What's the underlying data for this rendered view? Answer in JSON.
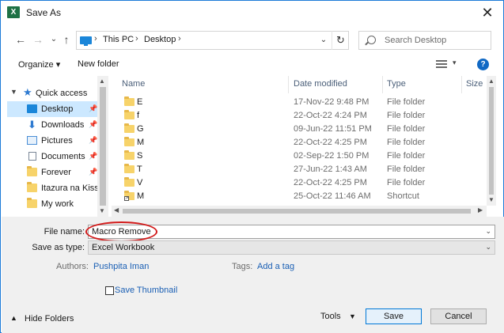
{
  "window": {
    "title": "Save As",
    "app_icon_letter": "X",
    "close_glyph": "✕"
  },
  "address": {
    "crumbs": [
      "This PC",
      "Desktop"
    ],
    "separator": "›",
    "dropdown_glyph": "⌄",
    "refresh_glyph": "↻",
    "back_glyph": "←",
    "forward_glyph": "→",
    "recent_glyph": "⌄",
    "up_glyph": "↑"
  },
  "search": {
    "placeholder": "Search Desktop"
  },
  "toolbar": {
    "organize_label": "Organize ▾",
    "new_folder_label": "New folder",
    "view_drop_glyph": "▾",
    "help_glyph": "?"
  },
  "nav": {
    "quick_access": "Quick access",
    "items": [
      {
        "label": "Desktop",
        "icon": "desktop-icon",
        "pinned": true,
        "selected": true
      },
      {
        "label": "Downloads",
        "icon": "download-icon",
        "pinned": true
      },
      {
        "label": "Pictures",
        "icon": "pictures-icon",
        "pinned": true
      },
      {
        "label": "Documents",
        "icon": "documents-icon",
        "pinned": true
      },
      {
        "label": "Forever",
        "icon": "folder-icon",
        "pinned": true
      },
      {
        "label": "Itazura na Kiss",
        "icon": "folder-icon"
      },
      {
        "label": "My work",
        "icon": "folder-icon"
      }
    ]
  },
  "columns": {
    "name": "Name",
    "date": "Date modified",
    "type": "Type",
    "size": "Size"
  },
  "files": [
    {
      "name": "E",
      "date": "17-Nov-22 9:48 PM",
      "type": "File folder"
    },
    {
      "name": "f",
      "date": "22-Oct-22 4:24 PM",
      "type": "File folder"
    },
    {
      "name": "G",
      "date": "09-Jun-22 11:51 PM",
      "type": "File folder"
    },
    {
      "name": "M",
      "date": "22-Oct-22 4:25 PM",
      "type": "File folder"
    },
    {
      "name": "S",
      "date": "02-Sep-22 1:50 PM",
      "type": "File folder"
    },
    {
      "name": "T",
      "date": "27-Jun-22 1:43 AM",
      "type": "File folder"
    },
    {
      "name": "V",
      "date": "22-Oct-22 4:25 PM",
      "type": "File folder"
    },
    {
      "name": "M",
      "date": "25-Oct-22 11:46 AM",
      "type": "Shortcut"
    }
  ],
  "form": {
    "file_name_label": "File name:",
    "file_name_value": "Macro Remove",
    "save_as_type_label": "Save as type:",
    "save_as_type_value": "Excel Workbook",
    "authors_label": "Authors:",
    "authors_value": "Pushpita Iman",
    "tags_label": "Tags:",
    "tags_value": "Add a tag",
    "thumbnail_label": "Save Thumbnail"
  },
  "footer": {
    "hide_folders": "Hide Folders",
    "tools": "Tools",
    "save": "Save",
    "cancel": "Cancel"
  },
  "colors": {
    "accent": "#0078d7",
    "selection": "#cce8ff",
    "highlight_oval": "#d21a1a",
    "link": "#1a5fb4"
  }
}
